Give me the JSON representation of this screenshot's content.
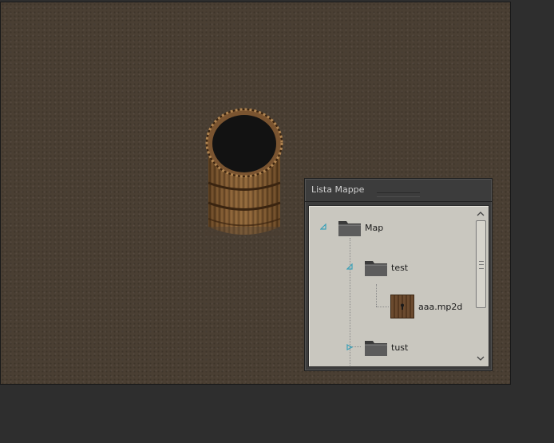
{
  "panel": {
    "title": "Lista Mappe"
  },
  "tree": {
    "root": {
      "label": "Map",
      "expanded": true
    },
    "children": [
      {
        "label": "test",
        "expanded": true
      },
      {
        "label": "aaa.mp2d",
        "type": "file"
      },
      {
        "label": "tust",
        "expanded": false
      }
    ]
  },
  "colors": {
    "background": "#2e2e2e",
    "map_ground": "#4a3f33",
    "panel_bg": "#3c3c3c",
    "tree_bg": "#c9c7bf",
    "expander_accent": "#3aa0b8"
  },
  "icons": {
    "scroll_up": "chevron-up-icon",
    "scroll_down": "chevron-down-icon"
  }
}
